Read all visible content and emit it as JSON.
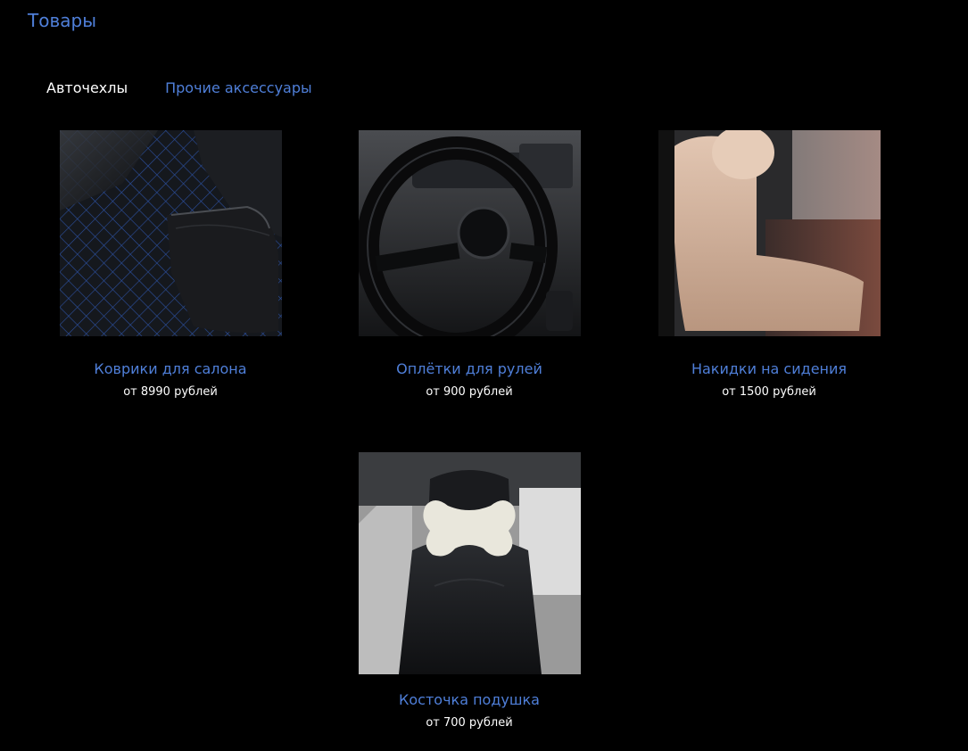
{
  "header": {
    "title": "Товары"
  },
  "tabs": [
    {
      "label": "Авточехлы",
      "active": true
    },
    {
      "label": "Прочие аксессуары",
      "active": false
    }
  ],
  "products": [
    {
      "name": "Коврики для салона",
      "price": "от 8990 рублей",
      "icon": "mat-photo"
    },
    {
      "name": "Оплётки для рулей",
      "price": "от 900 рублей",
      "icon": "steering-wheel-photo"
    },
    {
      "name": "Накидки на сидения",
      "price": "от 1500 рублей",
      "icon": "seat-cover-photo"
    },
    {
      "name": "Косточка подушка",
      "price": "от 700 рублей",
      "icon": "pillow-photo"
    }
  ],
  "colors": {
    "background": "#000000",
    "link": "#4f7fd9",
    "text": "#ffffff"
  }
}
